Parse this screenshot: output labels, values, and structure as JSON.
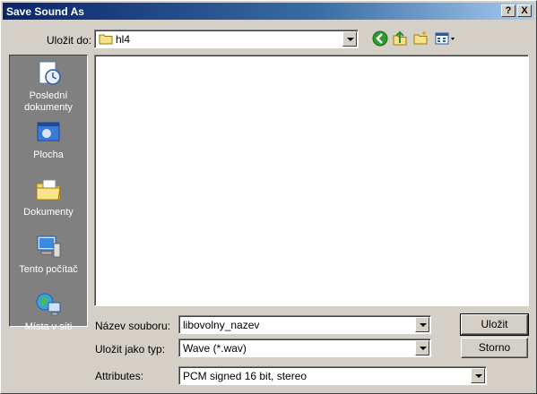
{
  "window": {
    "title": "Save Sound As",
    "help_button": "?",
    "close_button": "X"
  },
  "toolbar": {
    "lookin_label": "Uložit do:",
    "lookin_value": "hl4",
    "icons": [
      "back-icon",
      "up-folder-icon",
      "new-folder-icon",
      "views-menu-icon"
    ]
  },
  "places": [
    {
      "label": "Poslední dokumenty",
      "icon": "recent-documents-icon"
    },
    {
      "label": "Plocha",
      "icon": "desktop-icon"
    },
    {
      "label": "Dokumenty",
      "icon": "documents-folder-icon"
    },
    {
      "label": "Tento počítač",
      "icon": "my-computer-icon"
    },
    {
      "label": "Místa v síti",
      "icon": "network-places-icon"
    }
  ],
  "form": {
    "filename_label": "Název souboru:",
    "filename_value": "libovolny_nazev",
    "filetype_label": "Uložit jako typ:",
    "filetype_value": "Wave (*.wav)",
    "attributes_label": "Attributes:",
    "attributes_value": "PCM signed 16 bit, stereo"
  },
  "buttons": {
    "save": "Uložit",
    "cancel": "Storno"
  }
}
